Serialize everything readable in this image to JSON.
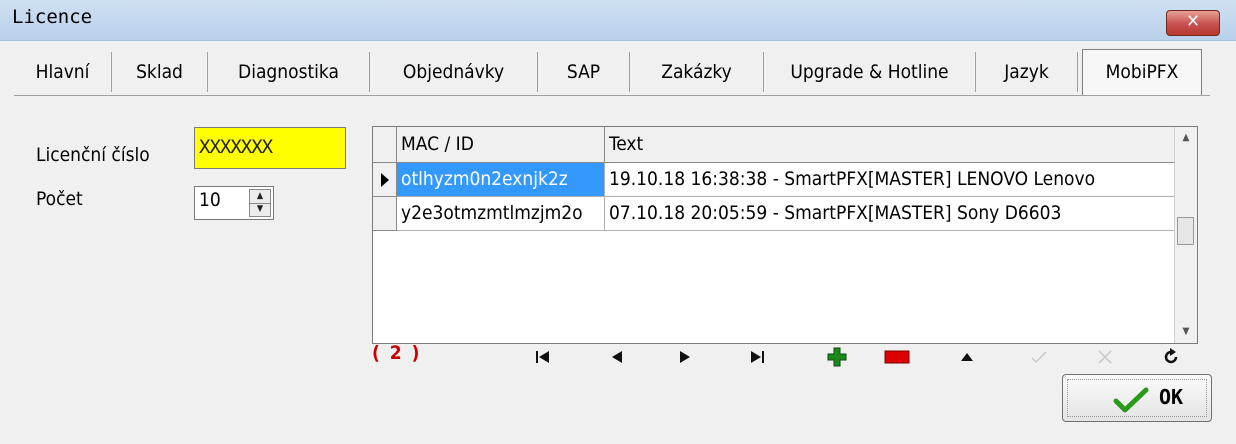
{
  "window": {
    "title": "Licence",
    "close_glyph": "✕"
  },
  "tabs": [
    {
      "label": "Hlavní",
      "active": false
    },
    {
      "label": "Sklad",
      "active": false
    },
    {
      "label": "Diagnostika",
      "active": false
    },
    {
      "label": "Objednávky",
      "active": false
    },
    {
      "label": "SAP",
      "active": false
    },
    {
      "label": "Zakázky",
      "active": false
    },
    {
      "label": "Upgrade & Hotline",
      "active": false
    },
    {
      "label": "Jazyk",
      "active": false
    },
    {
      "label": "MobiPFX",
      "active": true
    }
  ],
  "form": {
    "licence_label": "Licenční číslo",
    "licence_value": "XXXXXXX",
    "count_label": "Počet",
    "count_value": "10",
    "licence_highlight_color": "#ffff00"
  },
  "grid": {
    "columns": [
      "MAC / ID",
      "Text"
    ],
    "rows": [
      {
        "mac": "otlhyzm0n2exnjk2z",
        "text": "19.10.18 16:38:38 - SmartPFX[MASTER] LENOVO Lenovo",
        "selected": true
      },
      {
        "mac": "y2e3otmzmtlmzjm2o",
        "text": "07.10.18 20:05:59 - SmartPFX[MASTER] Sony D6603",
        "selected": false
      }
    ],
    "selection_color": "#3399ff"
  },
  "navigator": {
    "record_count": "( 2 )",
    "buttons": [
      {
        "name": "first-record-icon",
        "enabled": true
      },
      {
        "name": "prior-record-icon",
        "enabled": true
      },
      {
        "name": "next-record-icon",
        "enabled": true
      },
      {
        "name": "last-record-icon",
        "enabled": true
      },
      {
        "name": "insert-record-icon",
        "enabled": true,
        "color": "#1a8a1a"
      },
      {
        "name": "delete-record-icon",
        "enabled": true,
        "color": "#dd0000"
      },
      {
        "name": "edit-record-icon",
        "enabled": true
      },
      {
        "name": "post-record-icon",
        "enabled": false
      },
      {
        "name": "cancel-record-icon",
        "enabled": false
      },
      {
        "name": "refresh-record-icon",
        "enabled": true
      }
    ]
  },
  "ok_button": {
    "label": "OK",
    "icon": "checkmark-icon",
    "icon_color": "#2a9a1a"
  }
}
